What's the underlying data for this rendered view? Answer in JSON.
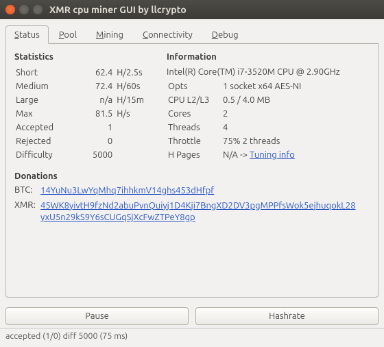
{
  "window": {
    "title": "XMR cpu miner GUI by llcrypto"
  },
  "tabs": [
    {
      "label": "Status",
      "accel_index": 0,
      "active": true
    },
    {
      "label": "Pool",
      "accel_index": 0
    },
    {
      "label": "Mining",
      "accel_index": 0
    },
    {
      "label": "Connectivity",
      "accel_index": 0
    },
    {
      "label": "Debug",
      "accel_index": 0
    }
  ],
  "statistics": {
    "heading": "Statistics",
    "rows": [
      {
        "label": "Short",
        "value": "62.4",
        "unit": "H/2.5s"
      },
      {
        "label": "Medium",
        "value": "72.4",
        "unit": "H/60s"
      },
      {
        "label": "Large",
        "value": "n/a",
        "unit": "H/15m"
      },
      {
        "label": "Max",
        "value": "81.5",
        "unit": "H/s"
      },
      {
        "label": "Accepted",
        "value": "1",
        "unit": ""
      },
      {
        "label": "Rejected",
        "value": "0",
        "unit": ""
      },
      {
        "label": "Difficulty",
        "value": "5000",
        "unit": ""
      }
    ]
  },
  "information": {
    "heading": "Information",
    "cpu": "Intel(R) Core(TM) i7-3520M CPU @ 2.90GHz",
    "rows": [
      {
        "label": "Opts",
        "value": "1 socket x64 AES-NI"
      },
      {
        "label": "CPU L2/L3",
        "value": "0.5 / 4.0 MB"
      },
      {
        "label": "Cores",
        "value": "2"
      },
      {
        "label": "Threads",
        "value": "4"
      },
      {
        "label": "Throttle",
        "value": "75% 2 threads"
      }
    ],
    "hpages": {
      "label": "H Pages",
      "prefix": "N/A -> ",
      "link": "Tuning info"
    }
  },
  "donations": {
    "heading": "Donations",
    "btc_label": "BTC:",
    "btc": "14YuNu3LwYqMhq7ihhkmV14ghs453dHfpf",
    "xmr_label": "XMR:",
    "xmr": "45WK8yivtH9fzNd2abuPvnQuiyj1D4Kji7BngXD2DV3pgMPPfsWok5ejhuqokL28yxU5n29kS9Y6sCUGqSjXcFwZTPeY8gp"
  },
  "buttons": {
    "pause": "Pause",
    "hashrate": "Hashrate"
  },
  "status_line": "accepted (1/0) diff 5000 (75 ms)"
}
